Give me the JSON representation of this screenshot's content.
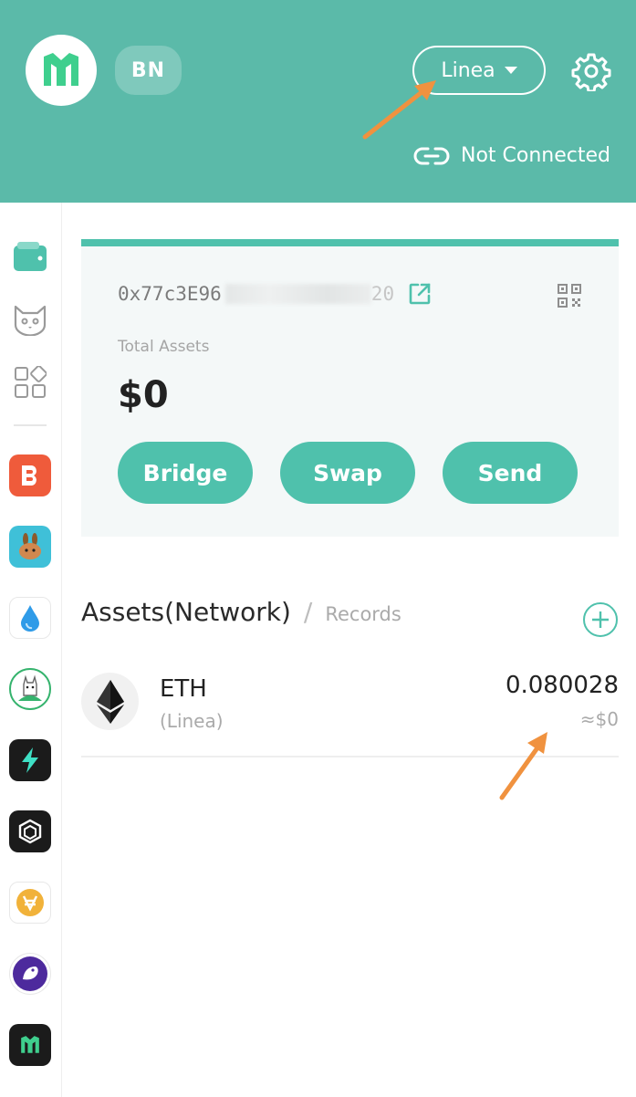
{
  "header": {
    "avatar_text": "BN",
    "network_label": "Linea",
    "connection_status": "Not Connected"
  },
  "sidebar": {
    "nav_items": [
      "wallet-icon",
      "cat-icon",
      "apps-grid-icon"
    ],
    "apps": [
      {
        "name": "app-b-icon",
        "color": "#ee5a3c"
      },
      {
        "name": "pancake-bunny-icon",
        "color": "#3fc0d8"
      },
      {
        "name": "drop-icon",
        "color": "#2f9be8"
      },
      {
        "name": "llama-icon",
        "color": "#35b36d"
      },
      {
        "name": "lightning-icon",
        "color": "#1b1b1b"
      },
      {
        "name": "hexagon-icon",
        "color": "#1b1b1b"
      },
      {
        "name": "coin-v-icon",
        "color": "#f1b23a"
      },
      {
        "name": "bird-icon",
        "color": "#4d2a9d"
      },
      {
        "name": "brand-m-icon",
        "color": "#1b1b1b"
      }
    ]
  },
  "wallet": {
    "address_prefix": "0x77c3E96",
    "address_suffix": "20",
    "total_label": "Total Assets",
    "total_value": "$0",
    "buttons": {
      "bridge": "Bridge",
      "swap": "Swap",
      "send": "Send"
    }
  },
  "assets": {
    "tab_active": "Assets(Network)",
    "tab_separator": "/",
    "tab_inactive": "Records",
    "items": [
      {
        "symbol": "ETH",
        "network": "(Linea)",
        "amount": "0.080028",
        "usd": "≈$0"
      }
    ]
  },
  "colors": {
    "brand": "#5bbaa9",
    "button": "#4fc1ac",
    "annotation_arrow": "#f0923f"
  }
}
